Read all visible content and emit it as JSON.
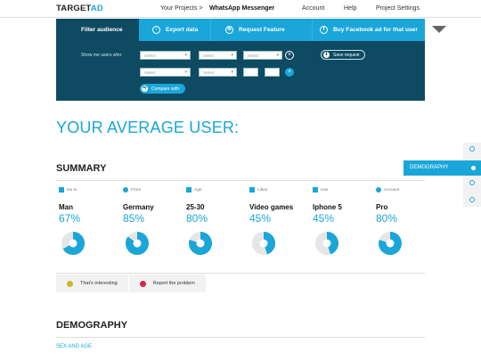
{
  "app": {
    "logo_main": "TARGET",
    "logo_accent": "AD"
  },
  "nav": {
    "projects": "Your Projects >",
    "current_project": "WhatsApp Messenger",
    "account": "Account",
    "help": "Help",
    "settings": "Project Settings"
  },
  "filter_panel": {
    "tabs": [
      {
        "label": "Filter audience"
      },
      {
        "label": "Export data",
        "icon": "upload-icon"
      },
      {
        "label": "Request Feature",
        "icon": "wifi-icon"
      },
      {
        "label": "Buy Facebook ad for that user",
        "icon": "facebook-icon"
      }
    ],
    "show_me_label": "Show me users who:",
    "row1": [
      "Select",
      "Select",
      "Select"
    ],
    "row2": [
      "Select",
      "Select"
    ],
    "save_request": "Save request",
    "compare_with": "Compare with:"
  },
  "headline": "YOUR AVERAGE USER:",
  "summary": {
    "title": "SUMMARY",
    "cards": [
      {
        "label": "He is",
        "value": "Man",
        "percent": "67%",
        "fraction": 0.67,
        "icon": "person-icon"
      },
      {
        "label": "From",
        "value": "Germany",
        "percent": "85%",
        "fraction": 0.85,
        "icon": "location-pin-icon"
      },
      {
        "label": "Age",
        "value": "25-30",
        "percent": "80%",
        "fraction": 0.8,
        "icon": "calendar-icon"
      },
      {
        "label": "Likes",
        "value": "Video games",
        "percent": "45%",
        "fraction": 0.45,
        "icon": "thumbs-up-icon"
      },
      {
        "label": "Use",
        "value": "Iphone 5",
        "percent": "45%",
        "fraction": 0.45,
        "icon": "phone-icon"
      },
      {
        "label": "Account",
        "value": "Pro",
        "percent": "80%",
        "fraction": 0.8,
        "icon": "account-plus-icon"
      }
    ],
    "interesting": "That's interesting",
    "report": "Report the problem"
  },
  "demography": {
    "title": "DEMOGRAPHY",
    "badge": "DEMOGRAPHY",
    "sex_and_age": "SEX AND AGE"
  },
  "colors": {
    "accent": "#1aa6d9",
    "panel": "#0e4a62",
    "interesting": "#c9b92a",
    "report": "#d6244c"
  }
}
